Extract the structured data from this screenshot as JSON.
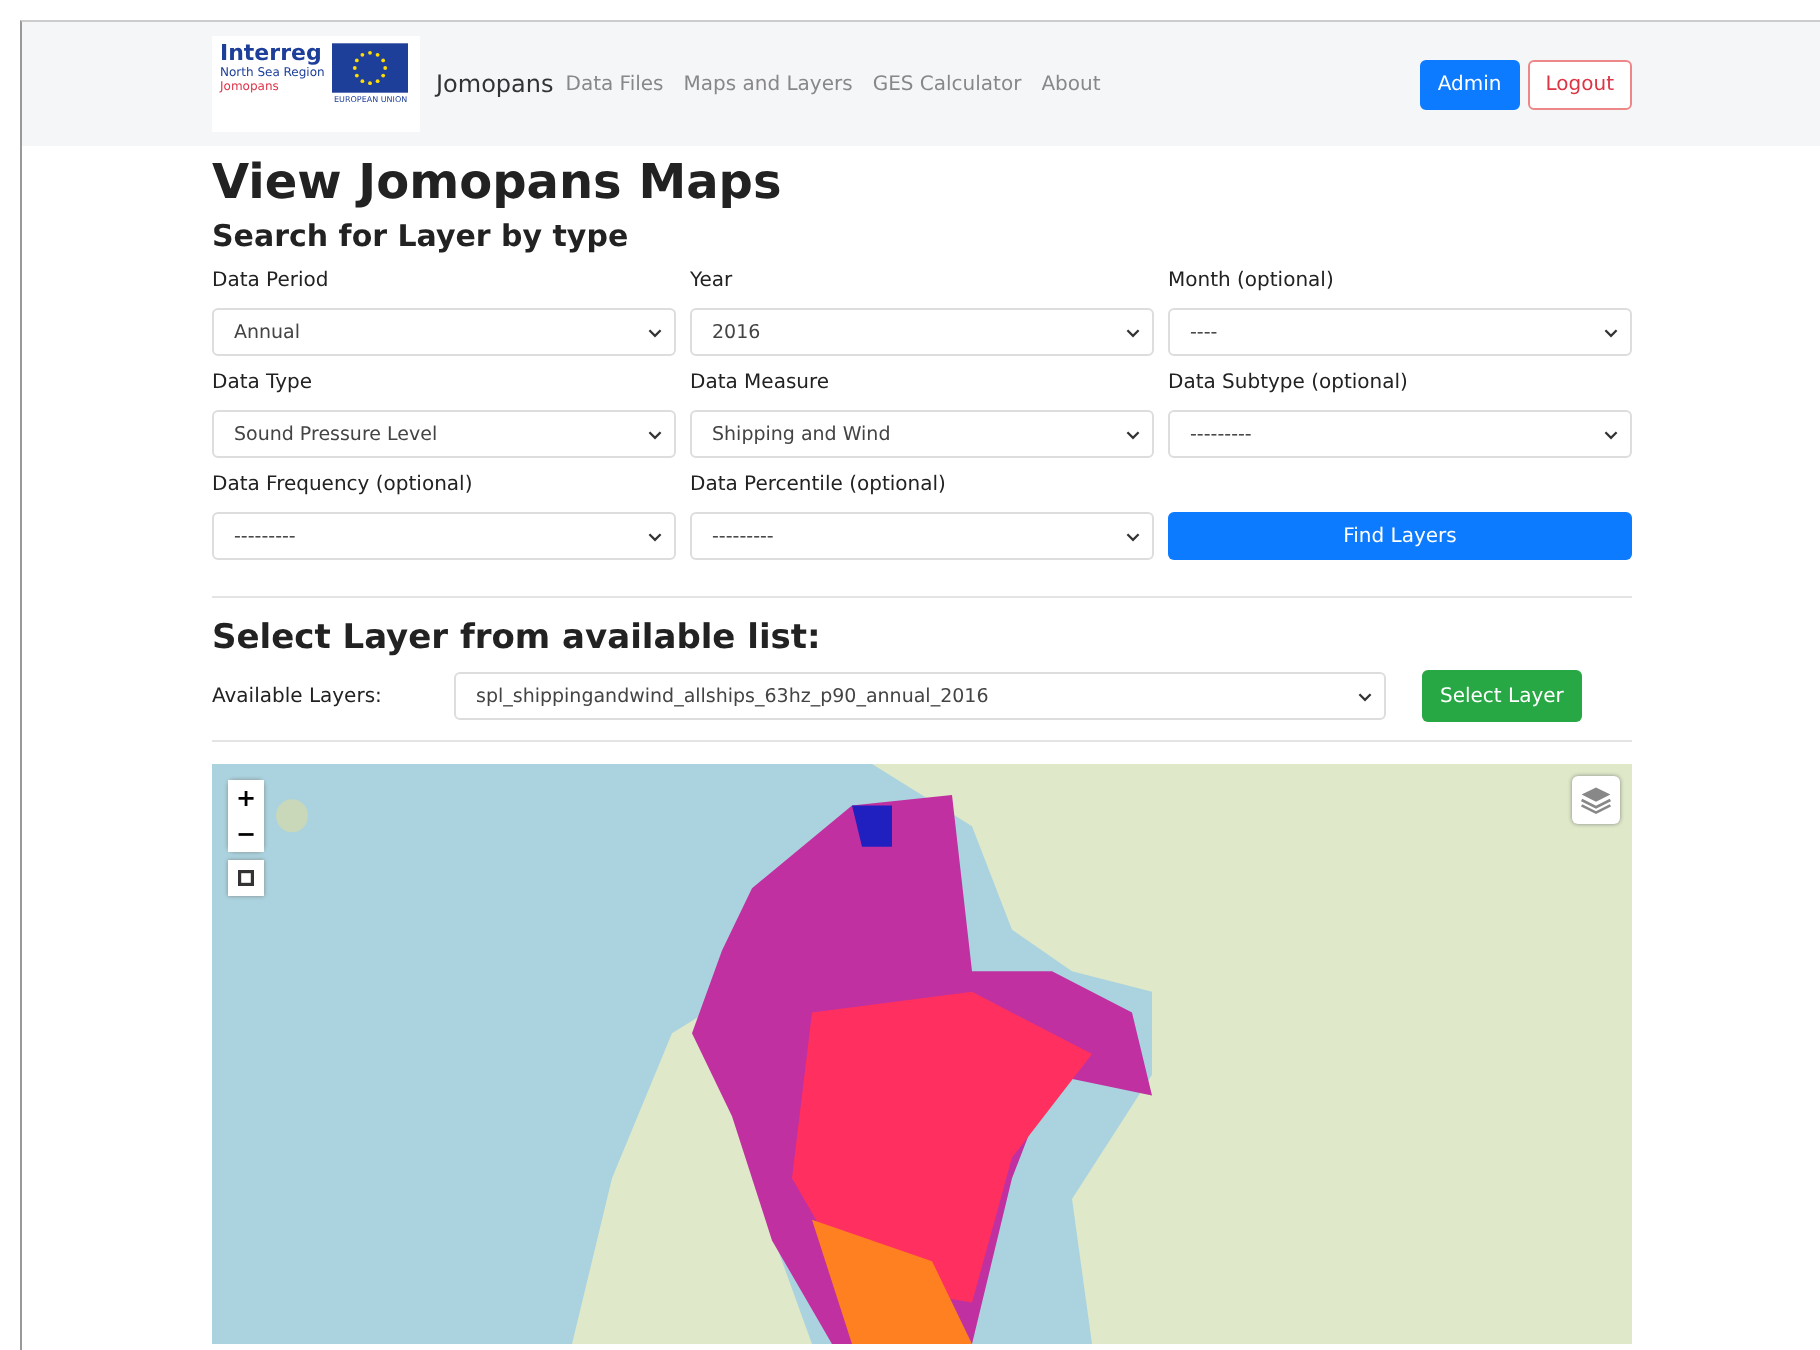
{
  "logo": {
    "line_1": "Interreg",
    "line_2": "North Sea Region",
    "line_3": "Jomopans",
    "eu_label": "EUROPEAN UNION"
  },
  "nav": {
    "brand": "Jomopans",
    "links": [
      {
        "label": "Data Files"
      },
      {
        "label": "Maps and Layers"
      },
      {
        "label": "GES Calculator"
      },
      {
        "label": "About"
      }
    ],
    "buttons": [
      {
        "label": "Admin",
        "kind": "primary"
      },
      {
        "label": "Logout",
        "kind": "outline-danger"
      }
    ]
  },
  "title": "View Jomopans Maps",
  "search": {
    "heading": "Search for Layer by type",
    "fields": [
      {
        "label": "Data Period",
        "value": "Annual"
      },
      {
        "label": "Year",
        "value": "2016"
      },
      {
        "label": "Month (optional)",
        "value": "----"
      },
      {
        "label": "Data Type",
        "value": "Sound Pressure Level"
      },
      {
        "label": "Data Measure",
        "value": "Shipping and Wind"
      },
      {
        "label": "Data Subtype (optional)",
        "value": "---------"
      },
      {
        "label": "Data Frequency (optional)",
        "value": "---------"
      },
      {
        "label": "Data Percentile (optional)",
        "value": "---------"
      }
    ],
    "button": "Find Layers"
  },
  "select": {
    "heading": "Select Layer from available list:",
    "label": "Available Layers:",
    "value": "spl_shippingandwind_allships_63hz_p90_annual_2016",
    "button": "Select Layer"
  },
  "map": {
    "zoom_in": "+",
    "zoom_out": "−"
  }
}
